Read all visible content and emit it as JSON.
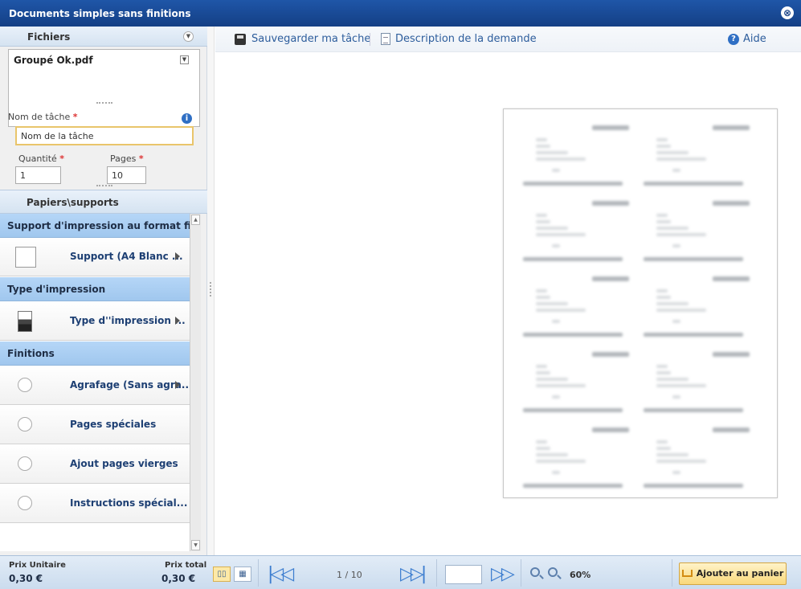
{
  "window": {
    "title": "Documents simples sans finitions",
    "close_glyph": "⊗"
  },
  "files": {
    "header": "Fichiers",
    "filename": "Groupé Ok.pdf"
  },
  "task": {
    "name_label": "Nom de tâche",
    "name_value": "Nom de la tâche",
    "quantity_label": "Quantité",
    "quantity_value": "1",
    "pages_label": "Pages",
    "pages_value": "10",
    "required_mark": "*"
  },
  "papers": {
    "header": "Papiers\\supports"
  },
  "sections": [
    {
      "title": "Support d'impression au format fini",
      "items": [
        {
          "label": "Support  (A4 Blanc ...",
          "icon": "paper-square-icon",
          "has_submenu": true
        }
      ]
    },
    {
      "title": "Type d'impression",
      "items": [
        {
          "label": "Type d''impression ...",
          "icon": "printer-icon",
          "has_submenu": true
        }
      ]
    },
    {
      "title": "Finitions",
      "items": [
        {
          "label": "Agrafage (Sans agra...",
          "icon": "radio-icon",
          "has_submenu": true
        },
        {
          "label": "Pages spéciales",
          "icon": "radio-icon",
          "has_submenu": false
        },
        {
          "label": "Ajout pages vierges",
          "icon": "radio-icon",
          "has_submenu": false
        },
        {
          "label": "Instructions spécial...",
          "icon": "radio-icon",
          "has_submenu": false
        }
      ]
    }
  ],
  "toolbar": {
    "save_label": "Sauvegarder ma tâche",
    "description_label": "Description de la demande",
    "help_label": "Aide"
  },
  "pricing": {
    "unit_label": "Prix Unitaire",
    "unit_value": "0,30 €",
    "total_label": "Prix total",
    "total_value": "0,30 €"
  },
  "pager": {
    "page_indicator": "1 / 10",
    "zoom": "60%"
  },
  "cart": {
    "label": "Ajouter au panier"
  },
  "colors": {
    "titlebar": "#1a4c9a",
    "section_header": "#a8cdf2",
    "link_text": "#1d3f73",
    "cart_button": "#f9d87b"
  }
}
